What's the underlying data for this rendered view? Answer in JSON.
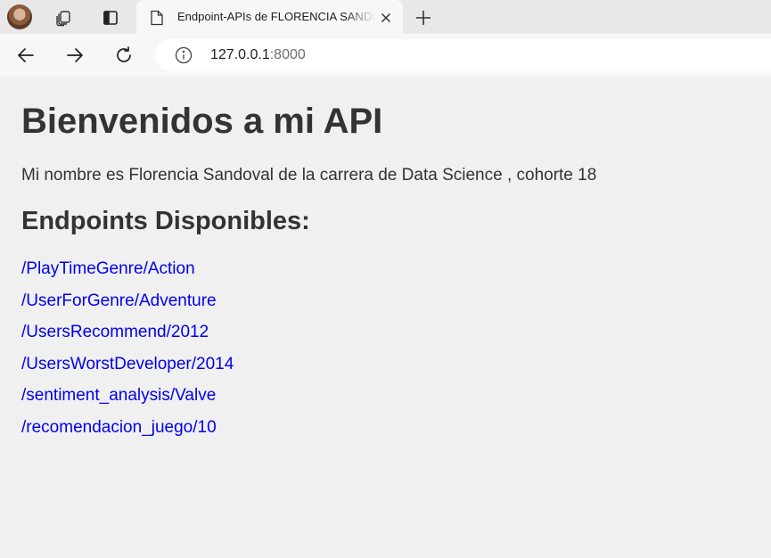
{
  "browser": {
    "tab": {
      "title": "Endpoint-APIs de FLORENCIA SANDOVAL"
    },
    "address_bar": {
      "host": "127.0.0.1",
      "port": ":8000"
    }
  },
  "page": {
    "heading": "Bienvenidos a mi API",
    "intro": "Mi nombre es Florencia Sandoval de la carrera de Data Science , cohorte 18",
    "endpoints_heading": "Endpoints Disponibles:",
    "endpoints": [
      "/PlayTimeGenre/Action",
      "/UserForGenre/Adventure",
      "/UsersRecommend/2012",
      "/UsersWorstDeveloper/2014",
      "/sentiment_analysis/Valve",
      "/recomendacion_juego/10"
    ]
  },
  "colors": {
    "link": "#0000ee",
    "text": "#333333",
    "background": "#f0f0f0"
  },
  "icons": [
    "profile-avatar",
    "workspaces-icon",
    "vertical-tabs-icon",
    "document-icon",
    "close-icon",
    "plus-icon",
    "back-arrow-icon",
    "forward-arrow-icon",
    "refresh-icon",
    "info-icon"
  ]
}
